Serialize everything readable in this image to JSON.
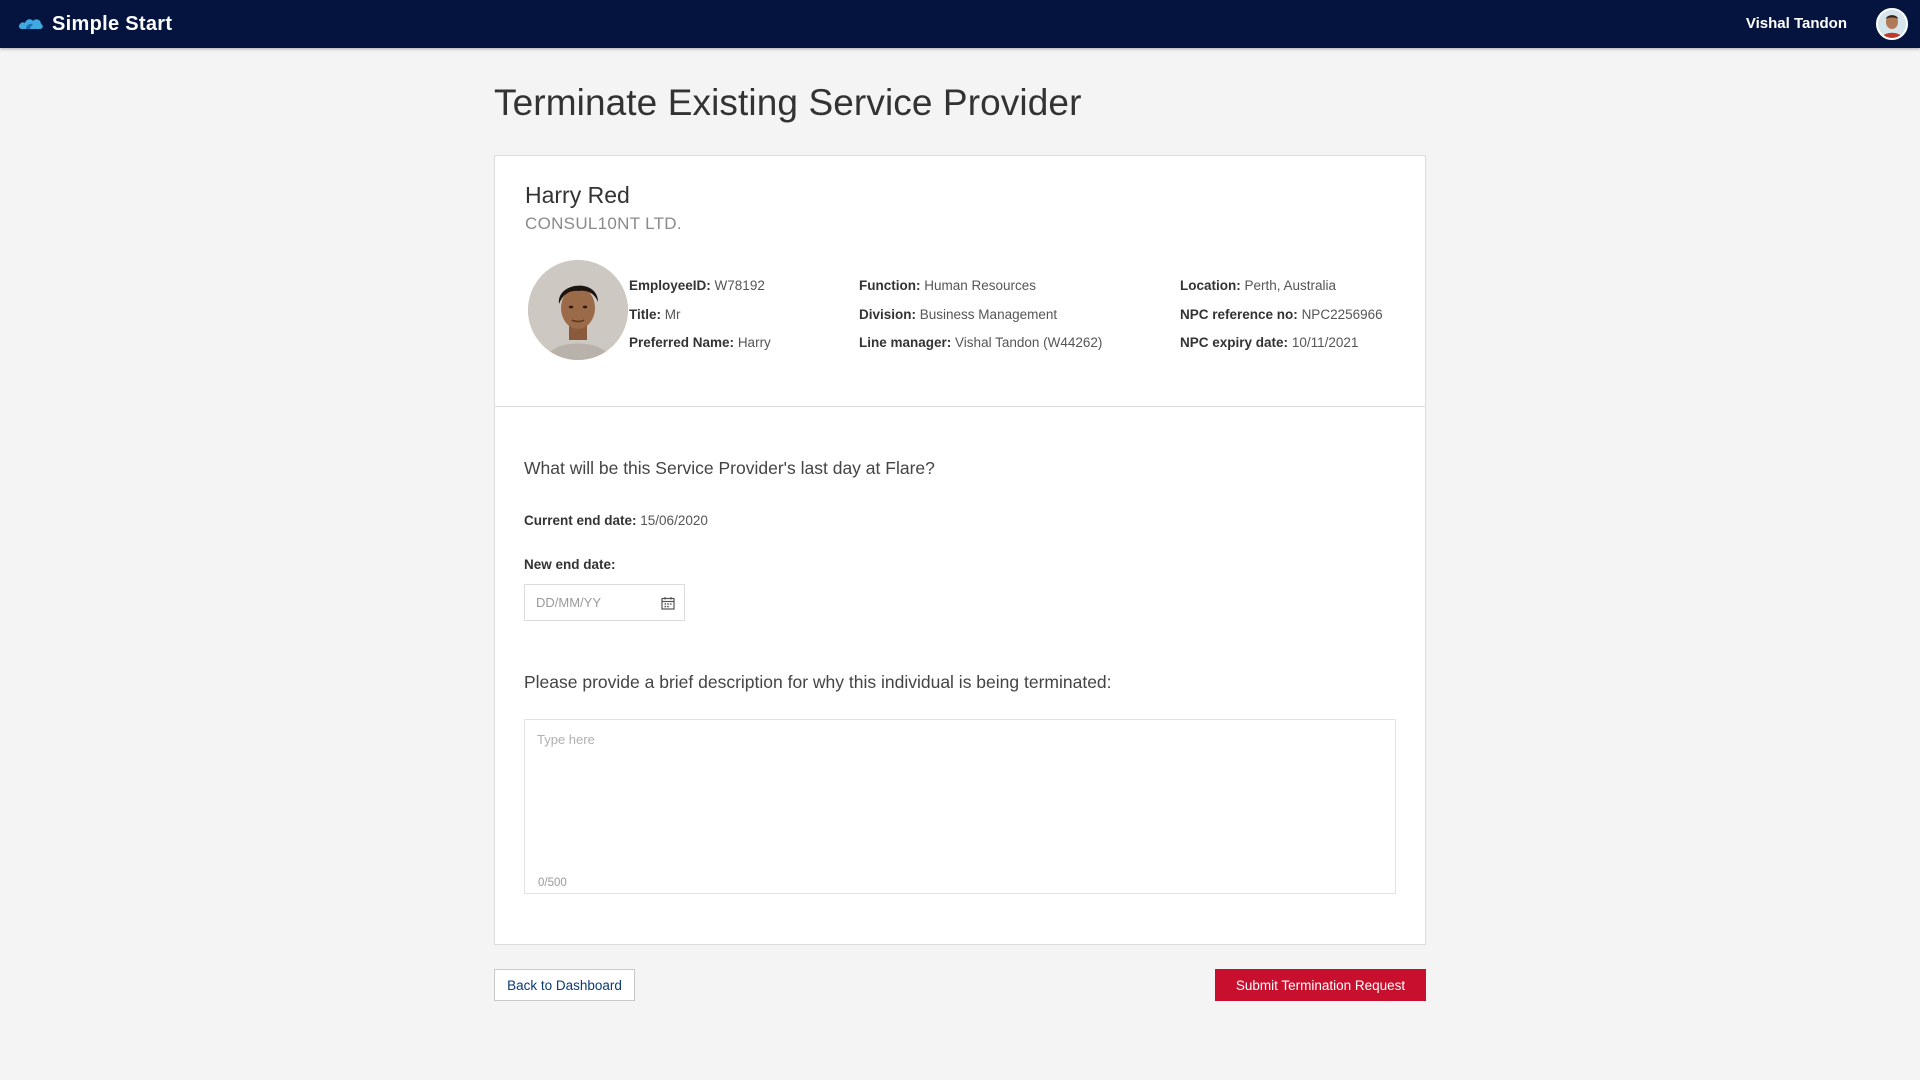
{
  "header": {
    "app_name": "Simple Start",
    "user_name": "Vishal Tandon",
    "brand_color": "#04143f"
  },
  "page": {
    "title": "Terminate Existing Service Provider"
  },
  "profile": {
    "name": "Harry Red",
    "company": "CONSUL10NT LTD.",
    "fields": {
      "employee_id": {
        "label": "EmployeeID:",
        "value": "W78192"
      },
      "title": {
        "label": "Title:",
        "value": "Mr"
      },
      "preferred_name": {
        "label": "Preferred Name:",
        "value": "Harry"
      },
      "function": {
        "label": "Function:",
        "value": "Human Resources"
      },
      "division": {
        "label": "Division:",
        "value": "Business Management"
      },
      "line_manager": {
        "label": "Line manager:",
        "value": "Vishal Tandon (W44262)"
      },
      "location": {
        "label": "Location:",
        "value": "Perth, Australia"
      },
      "npc_reference": {
        "label": "NPC reference no:",
        "value": "NPC2256966"
      },
      "npc_expiry": {
        "label": "NPC expiry date:",
        "value": "10/11/2021"
      }
    }
  },
  "form": {
    "last_day_question": "What will be this Service Provider's last day at Flare?",
    "current_end_label": "Current end date:",
    "current_end_value": "15/06/2020",
    "new_end_label": "New end date:",
    "date_placeholder": "DD/MM/YY",
    "description_question": "Please provide a brief description for why this individual is being terminated:",
    "description_placeholder": "Type here",
    "char_count": "0/500"
  },
  "actions": {
    "back_label": "Back to Dashboard",
    "submit_label": "Submit Termination Request",
    "submit_color": "#c8102e"
  }
}
